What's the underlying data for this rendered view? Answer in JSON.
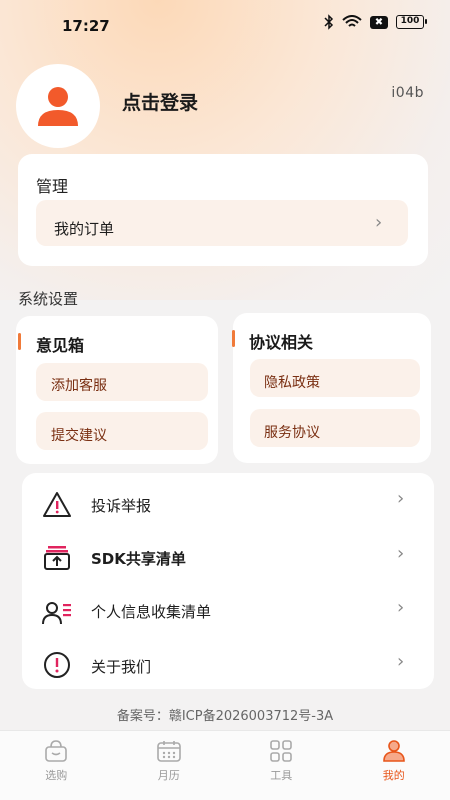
{
  "status_bar": {
    "time": "17:27",
    "battery": "100",
    "x_badge": "✖"
  },
  "profile": {
    "login_text": "点击登录",
    "version": "i04b"
  },
  "manage": {
    "title": "管理",
    "orders_label": "我的订单"
  },
  "system_settings": {
    "title": "系统设置",
    "feedback": {
      "title": "意见箱",
      "items": [
        "添加客服",
        "提交建议"
      ]
    },
    "protocol": {
      "title": "协议相关",
      "items": [
        "隐私政策",
        "服务协议"
      ]
    }
  },
  "list": {
    "items": [
      {
        "label": "投诉举报",
        "icon": "warning-icon"
      },
      {
        "label": "SDK共享清单",
        "icon": "share-icon"
      },
      {
        "label": "个人信息收集清单",
        "icon": "user-list-icon"
      },
      {
        "label": "关于我们",
        "icon": "info-icon"
      }
    ]
  },
  "icp": "备案号：赣ICP备2026003712号-3A",
  "tabs": [
    {
      "label": "选购",
      "icon": "bag-icon",
      "active": false
    },
    {
      "label": "月历",
      "icon": "calendar-icon",
      "active": false
    },
    {
      "label": "工具",
      "icon": "grid-icon",
      "active": false
    },
    {
      "label": "我的",
      "icon": "profile-icon",
      "active": true
    }
  ],
  "colors": {
    "accent": "#f07a39",
    "avatar": "#f25a2b",
    "pill_bg": "#fbf1ea",
    "pill_text": "#7a2f12",
    "tab_active": "#e8561b"
  }
}
